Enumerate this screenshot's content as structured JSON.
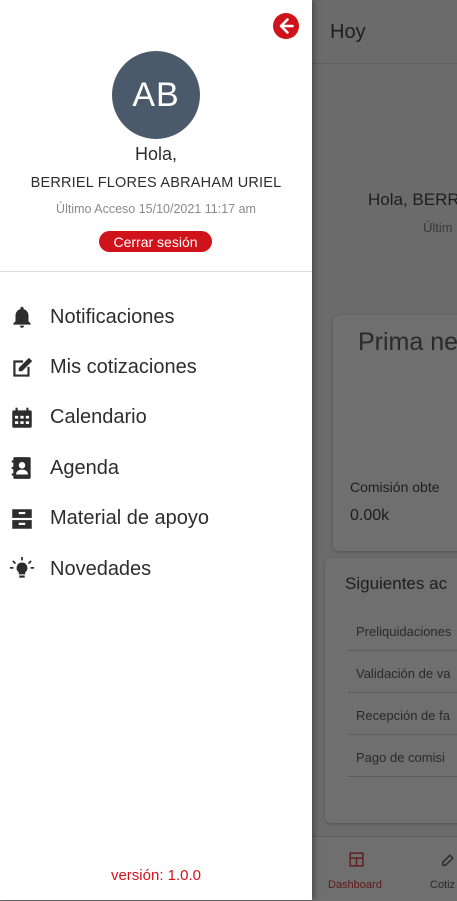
{
  "background": {
    "appbar_title": "Hoy",
    "greeting_partial": "Hola, BERRI",
    "last_access_partial": "Últim",
    "card_title_partial": "Prima ne",
    "comision_label_partial": "Comisión obte",
    "comision_value": "0.00k",
    "next_actions_title_partial": "Siguientes ac",
    "next_actions": [
      "Preliquidaciones",
      "Validación de va",
      "Recepción de fa",
      "Pago de comisi"
    ],
    "bottom_nav": [
      "Dashboard",
      "Cotiz"
    ]
  },
  "drawer": {
    "avatar_initials": "AB",
    "greeting": "Hola,",
    "username": "BERRIEL FLORES ABRAHAM URIEL",
    "last_access": "Último Acceso 15/10/2021 11:17 am",
    "logout_label": "Cerrar sesión",
    "menu": [
      {
        "label": "Notificaciones",
        "icon": "bell-icon"
      },
      {
        "label": "Mis cotizaciones",
        "icon": "edit-icon"
      },
      {
        "label": "Calendario",
        "icon": "calendar-icon"
      },
      {
        "label": "Agenda",
        "icon": "contacts-icon"
      },
      {
        "label": "Material de apoyo",
        "icon": "archive-icon"
      },
      {
        "label": "Novedades",
        "icon": "lightbulb-icon"
      }
    ],
    "version": "versión: 1.0.0"
  },
  "colors": {
    "accent": "#d0121b",
    "avatar": "#4b5a6b",
    "overlay": "#6b6b6b"
  }
}
